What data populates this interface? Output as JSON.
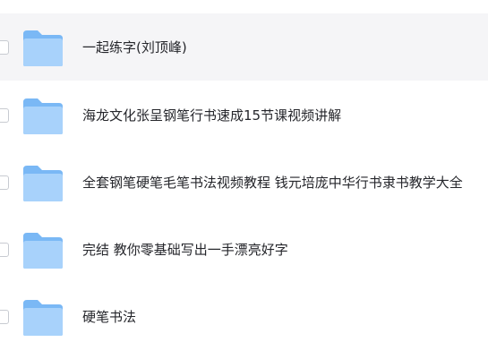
{
  "folders": [
    {
      "name": "一起练字(刘顶峰)",
      "icon": "folder-icon"
    },
    {
      "name": "海龙文化张呈钢笔行书速成15节课视频讲解",
      "icon": "folder-icon"
    },
    {
      "name": "全套钢笔硬笔毛笔书法视频教程 钱元培庞中华行书隶书教学大全",
      "icon": "folder-icon"
    },
    {
      "name": "完结 教你零基础写出一手漂亮好字",
      "icon": "folder-icon"
    },
    {
      "name": "硬笔书法",
      "icon": "folder-icon"
    }
  ],
  "colors": {
    "folder_front": "#a8d2fb",
    "folder_back": "#7ab8f5",
    "hover_row": "#f5f5f7",
    "text": "#25262b"
  }
}
